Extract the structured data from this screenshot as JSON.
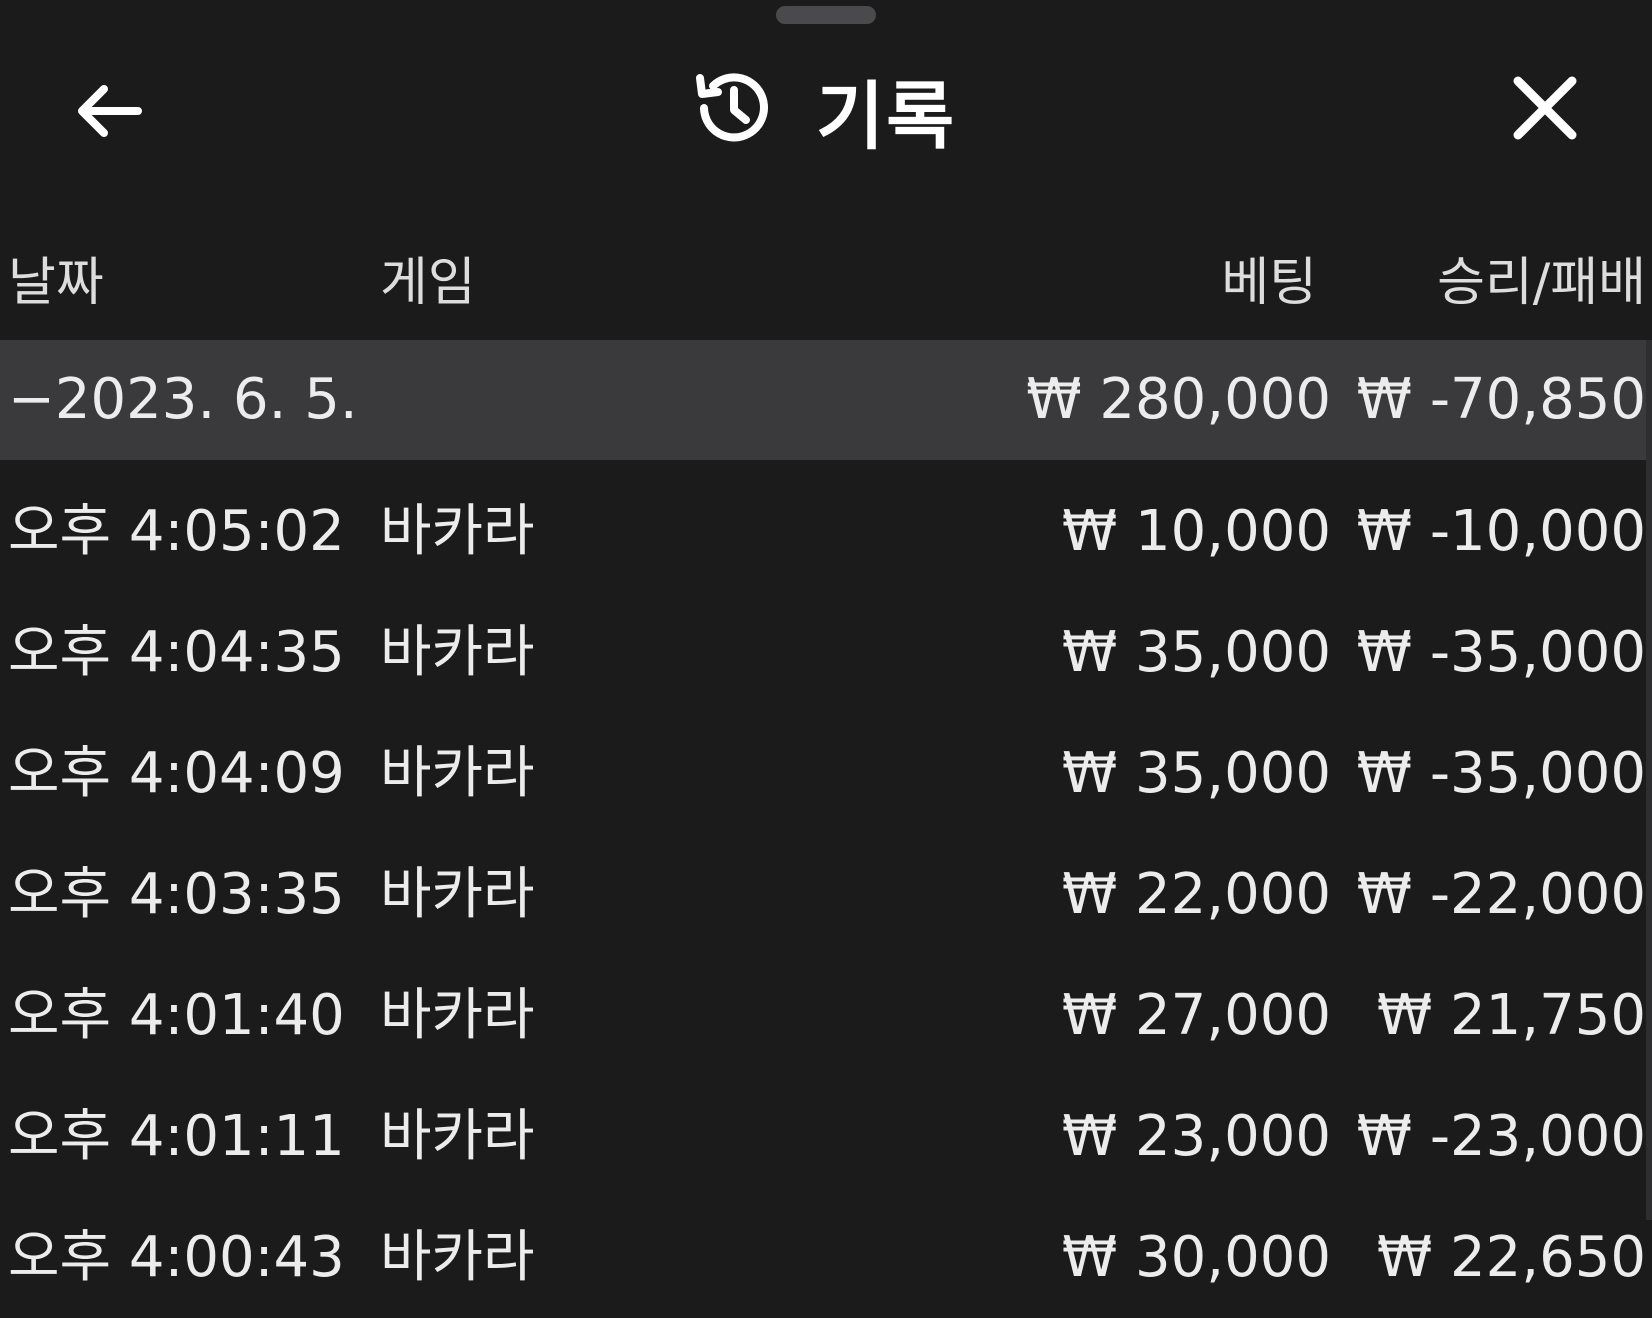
{
  "header": {
    "title": "기록",
    "back_icon": "arrow-left-icon",
    "history_icon": "history-clock-icon",
    "close_icon": "close-icon"
  },
  "columns": {
    "date": "날짜",
    "game": "게임",
    "bet": "베팅",
    "win_loss": "승리/패배"
  },
  "summary": {
    "date": "−2023. 6. 5.",
    "bet": "₩ 280,000",
    "win_loss": "₩ -70,850"
  },
  "rows": [
    {
      "time": "오후 4:05:02",
      "game": "바카라",
      "bet": "₩ 10,000",
      "win_loss": "₩ -10,000"
    },
    {
      "time": "오후 4:04:35",
      "game": "바카라",
      "bet": "₩ 35,000",
      "win_loss": "₩ -35,000"
    },
    {
      "time": "오후 4:04:09",
      "game": "바카라",
      "bet": "₩ 35,000",
      "win_loss": "₩ -35,000"
    },
    {
      "time": "오후 4:03:35",
      "game": "바카라",
      "bet": "₩ 22,000",
      "win_loss": "₩ -22,000"
    },
    {
      "time": "오후 4:01:40",
      "game": "바카라",
      "bet": "₩ 27,000",
      "win_loss": "₩ 21,750"
    },
    {
      "time": "오후 4:01:11",
      "game": "바카라",
      "bet": "₩ 23,000",
      "win_loss": "₩ -23,000"
    },
    {
      "time": "오후 4:00:43",
      "game": "바카라",
      "bet": "₩ 30,000",
      "win_loss": "₩ 22,650"
    }
  ],
  "colors": {
    "background": "#1b1b1c",
    "summary_row": "#3a3a3c",
    "text": "#ececec"
  }
}
